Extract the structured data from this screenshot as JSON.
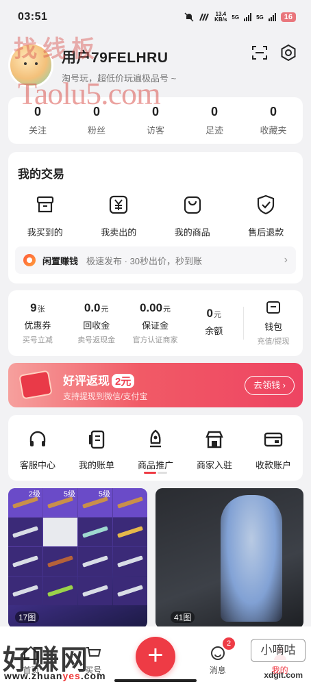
{
  "status_bar": {
    "time": "03:51",
    "net_speed_top": "13.4",
    "net_speed_bottom": "KB/s",
    "sig1": "5G",
    "sig2": "5G",
    "battery": "16"
  },
  "header": {
    "username": "用户79FELHRU",
    "subtitle": "淘号玩，超低价玩遍极品号 ~",
    "watermark_cn": "找线板",
    "watermark_en": "Taolu5.com"
  },
  "stats": [
    {
      "value": "0",
      "label": "关注"
    },
    {
      "value": "0",
      "label": "粉丝"
    },
    {
      "value": "0",
      "label": "访客"
    },
    {
      "value": "0",
      "label": "足迹"
    },
    {
      "value": "0",
      "label": "收藏夹"
    }
  ],
  "trade": {
    "title": "我的交易",
    "items": [
      {
        "label": "我买到的",
        "icon": "box-icon"
      },
      {
        "label": "我卖出的",
        "icon": "yen-icon"
      },
      {
        "label": "我的商品",
        "icon": "bag-icon"
      },
      {
        "label": "售后退款",
        "icon": "shield-icon"
      }
    ],
    "xianzhi": {
      "main": "闲置赚钱",
      "desc": "极速发布 · 30秒出价，秒到账"
    }
  },
  "wallet": {
    "items": [
      {
        "value": "9",
        "unit": "张",
        "label": "优惠券",
        "sub": "买号立减"
      },
      {
        "value": "0.0",
        "unit": "元",
        "label": "回收金",
        "sub": "卖号返现金"
      },
      {
        "value": "0.00",
        "unit": "元",
        "label": "保证金",
        "sub": "官方认证商家"
      },
      {
        "value": "0",
        "unit": "元",
        "label": "余额",
        "sub": ""
      }
    ],
    "purse": {
      "label": "钱包",
      "sub": "充值/提现"
    }
  },
  "banner": {
    "title": "好评返现",
    "amount": "2元",
    "sub": "支持提现到微信/支付宝",
    "button": "去领钱 ›"
  },
  "services": [
    {
      "label": "客服中心",
      "icon": "headset-icon"
    },
    {
      "label": "我的账单",
      "icon": "bill-icon"
    },
    {
      "label": "商品推广",
      "icon": "rocket-icon"
    },
    {
      "label": "商家入驻",
      "icon": "store-icon"
    },
    {
      "label": "收款账户",
      "icon": "card-icon"
    }
  ],
  "tiles": [
    {
      "count": "17图",
      "levels": [
        "2级",
        "5级",
        "5级"
      ]
    },
    {
      "count": "41图"
    }
  ],
  "tabbar": {
    "home": "首页",
    "buy": "买号",
    "message": "消息",
    "message_badge": "2",
    "mine": "我的"
  },
  "watermarks": {
    "left_big": "好赚网",
    "left_url_a": "www.zhuan",
    "left_url_b": "yes",
    "left_url_c": ".com",
    "right_box": "小嘀咕",
    "right_url": "xdgit.com"
  },
  "colors": {
    "accent": "#ee3b45",
    "banner_start": "#f6a09d",
    "banner_end": "#ee4462"
  }
}
